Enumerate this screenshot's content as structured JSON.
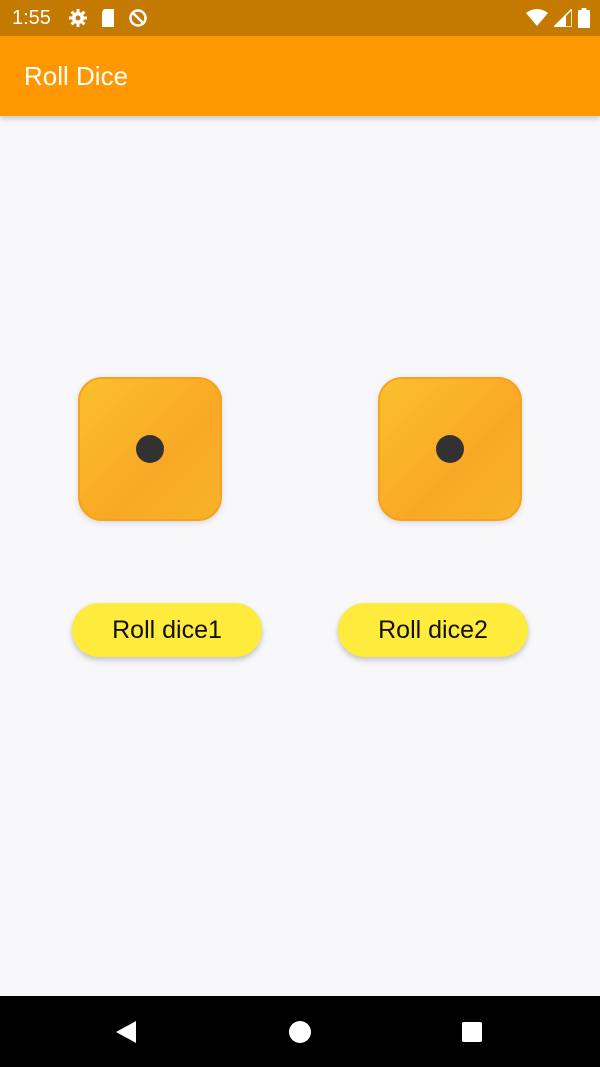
{
  "status_bar": {
    "time": "1:55",
    "left_icons": [
      "gear-icon",
      "sd-card-icon",
      "do-not-disturb-icon"
    ],
    "right_icons": [
      "wifi-icon",
      "signal-icon",
      "battery-icon"
    ]
  },
  "app_bar": {
    "title": "Roll Dice",
    "color": "#ff9800"
  },
  "dice": [
    {
      "value": 1
    },
    {
      "value": 1
    }
  ],
  "buttons": {
    "roll1_label": "Roll dice1",
    "roll2_label": "Roll dice2",
    "color": "#ffeb3b"
  },
  "nav_bar": {
    "icons": [
      "back-icon",
      "home-icon",
      "recents-icon"
    ]
  }
}
